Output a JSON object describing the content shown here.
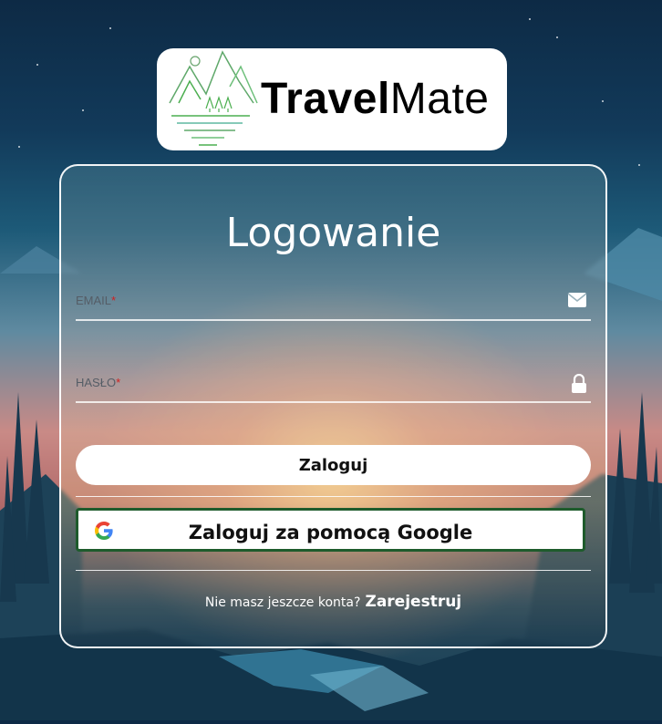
{
  "logo": {
    "brand_bold": "Travel",
    "brand_thin": "Mate",
    "colors": {
      "green": "#4caf50",
      "teal": "#5fb8a0"
    }
  },
  "login": {
    "title": "Logowanie",
    "email_label": "EMAIL",
    "password_label": "HASŁO",
    "required_mark": "*",
    "email_value": "",
    "password_value": "",
    "login_button": "Zaloguj",
    "google_button": "Zaloguj za pomocą Google",
    "no_account_text": "Nie masz jeszcze konta?",
    "register_link": "Zarejestruj"
  },
  "icons": {
    "email": "envelope-icon",
    "password": "lock-icon",
    "google": "google-g-icon"
  },
  "colors": {
    "required": "#d02020",
    "google_border": "#1e5b2c",
    "card_border": "#ffffff"
  }
}
